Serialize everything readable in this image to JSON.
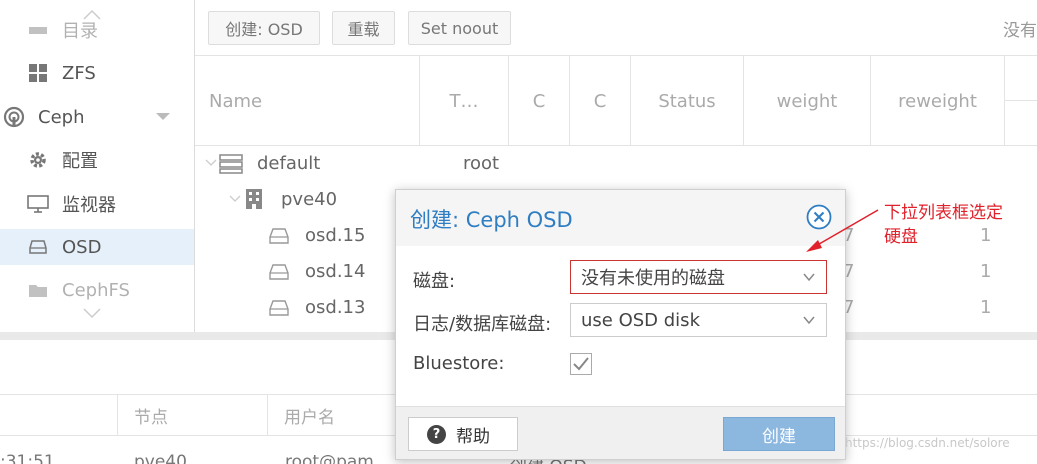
{
  "sidebar": {
    "items": [
      {
        "label": "目录",
        "icon": "storage-icon"
      },
      {
        "label": "ZFS",
        "icon": "grid-icon"
      },
      {
        "label": "Ceph",
        "icon": "ceph-icon"
      },
      {
        "label": "配置",
        "icon": "gear-icon"
      },
      {
        "label": "监视器",
        "icon": "monitor-icon"
      },
      {
        "label": "OSD",
        "icon": "drive-icon"
      },
      {
        "label": "CephFS",
        "icon": "folder-icon"
      }
    ]
  },
  "toolbar": {
    "create_osd": "创建: OSD",
    "reload": "重载",
    "set_noout": "Set noout",
    "right_text": "没有"
  },
  "grid": {
    "columns": [
      "Name",
      "T…",
      "C",
      "C",
      "Status",
      "weight",
      "reweight"
    ],
    "rows": [
      {
        "name": "default",
        "type": "root"
      },
      {
        "name": "pve40"
      },
      {
        "name": "osd.15",
        "c": "7",
        "reweight": "1"
      },
      {
        "name": "osd.14",
        "c": "7",
        "reweight": "1"
      },
      {
        "name": "osd.13",
        "c": "7",
        "reweight": "1"
      }
    ]
  },
  "lower": {
    "columns": [
      "节点",
      "用户名"
    ],
    "row": {
      "time": ":31:51",
      "node": "pve40",
      "user": "root@pam",
      "status": "创建 OSD"
    }
  },
  "modal": {
    "title": "创建: Ceph OSD",
    "disk_label": "磁盘:",
    "disk_value": "没有未使用的磁盘",
    "journal_label": "日志/数据库磁盘:",
    "journal_value": "use OSD disk",
    "bluestore_label": "Bluestore:",
    "bluestore_checked": true,
    "help_label": "帮助",
    "create_label": "创建"
  },
  "annotation": {
    "line1": "下拉列表框选定",
    "line2": "硬盘",
    "color": "#e0202b"
  },
  "watermark": "https://blog.csdn.net/solore",
  "colors": {
    "accent": "#2f7dc2",
    "invalid": "#cc3333",
    "create_btn": "#8cb8e0"
  }
}
